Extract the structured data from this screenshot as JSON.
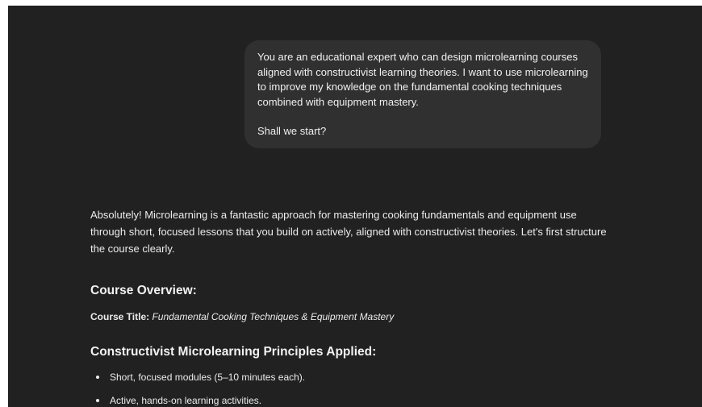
{
  "conversation": {
    "user_message": {
      "paragraph_1": "You are an educational expert who can design microlearning courses aligned with constructivist learning theories. I want to use microlearning to improve my knowledge on the fundamental cooking techniques combined with equipment mastery.",
      "paragraph_2": "Shall we start?"
    },
    "assistant_message": {
      "intro": "Absolutely! Microlearning is a fantastic approach for mastering cooking fundamentals and equipment use through short, focused lessons that you build on actively, aligned with constructivist theories. Let's first structure the course clearly.",
      "overview_heading": "Course Overview:",
      "course_title_label": "Course Title:",
      "course_title_value": "Fundamental Cooking Techniques & Equipment Mastery",
      "principles_heading": "Constructivist Microlearning Principles Applied:",
      "principles": [
        "Short, focused modules (5–10 minutes each).",
        "Active, hands-on learning activities."
      ]
    }
  },
  "colors": {
    "background": "#212121",
    "user_bubble": "#303030",
    "text": "#ececec"
  }
}
